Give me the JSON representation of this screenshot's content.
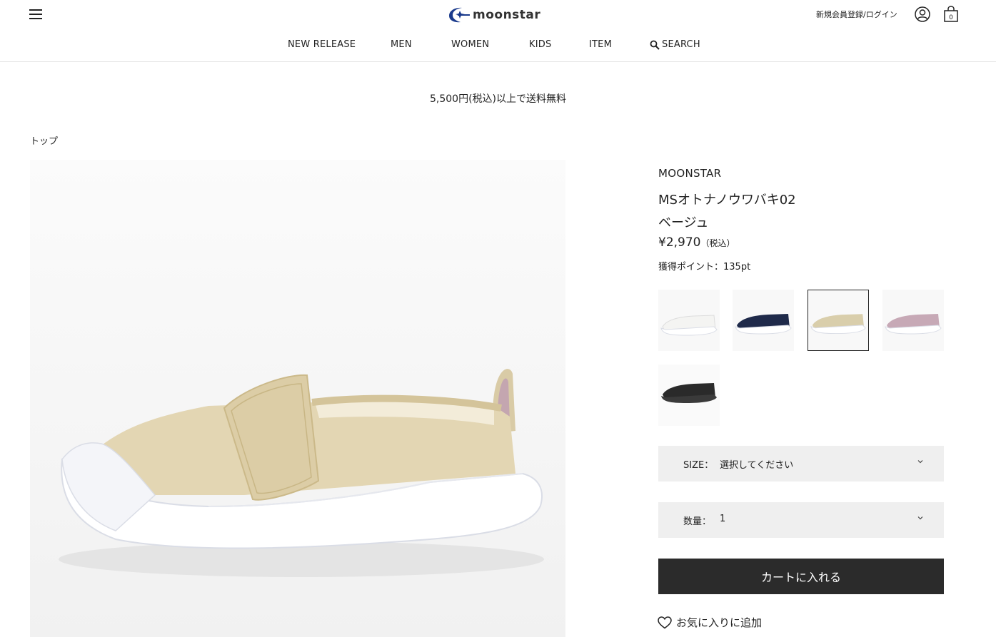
{
  "header": {
    "logo_text": "moonstar",
    "login_label": "新規会員登録/ログイン",
    "cart_count": "0",
    "nav": [
      {
        "label": "NEW RELEASE"
      },
      {
        "label": "MEN"
      },
      {
        "label": "WOMEN"
      },
      {
        "label": "KIDS"
      },
      {
        "label": "ITEM"
      },
      {
        "label": "SEARCH"
      }
    ]
  },
  "banner": "5,500円(税込)以上で送料無料",
  "breadcrumb": "トップ",
  "product": {
    "brand": "MOONSTAR",
    "name": "MSオトナノウワバキ02",
    "color": "ベージュ",
    "price": "¥2,970",
    "price_tax": "（税込）",
    "points": "獲得ポイント：135pt",
    "swatches": [
      {
        "color": "white",
        "hex": "#f4f4f2",
        "selected": false
      },
      {
        "color": "navy",
        "hex": "#1f2a4a",
        "selected": false
      },
      {
        "color": "beige",
        "hex": "#d9ceab",
        "selected": true
      },
      {
        "color": "pink",
        "hex": "#c7a9b6",
        "selected": false
      },
      {
        "color": "black",
        "hex": "#2a2a2a",
        "selected": false
      }
    ],
    "size_label": "SIZE：",
    "size_value": "選択してください",
    "qty_label": "数量：",
    "qty_value": "1",
    "cart_button": "カートに入れる",
    "favorite": "お気に入りに追加"
  },
  "colors": {
    "brand_blue": "#1a3a8c",
    "button_dark": "#2b2b2b",
    "select_bg": "#efefef"
  }
}
